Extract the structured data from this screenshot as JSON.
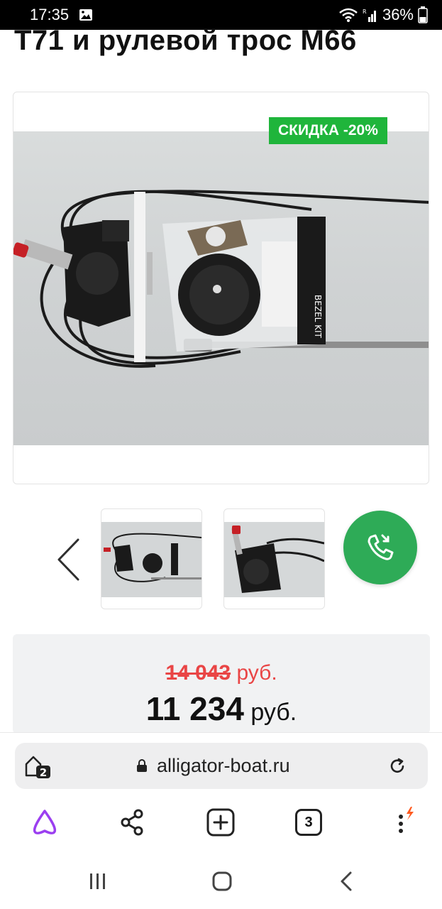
{
  "status_bar": {
    "time": "17:35",
    "battery": "36%",
    "icons": [
      "image-icon",
      "wifi-icon",
      "signal-icon",
      "battery-icon"
    ]
  },
  "page": {
    "title": "Т71 и рулевой трос М66"
  },
  "product": {
    "badge": "СКИДКА -20%",
    "badge_color": "#1fb53b",
    "old_price": "14 043",
    "old_price_currency": "руб.",
    "new_price": "11 234",
    "new_price_currency": "руб.",
    "old_price_color": "#e94545"
  },
  "gallery": {
    "prev_icon": "chevron-left-icon",
    "thumbnails": [
      "thumbnail-1",
      "thumbnail-2"
    ],
    "call_icon": "phone-call-icon",
    "call_color": "#2eab57"
  },
  "browser": {
    "tabs_badge": "2",
    "url": "alligator-boat.ru",
    "tabs_count": "3",
    "accent_color": "#9b3ff0"
  }
}
